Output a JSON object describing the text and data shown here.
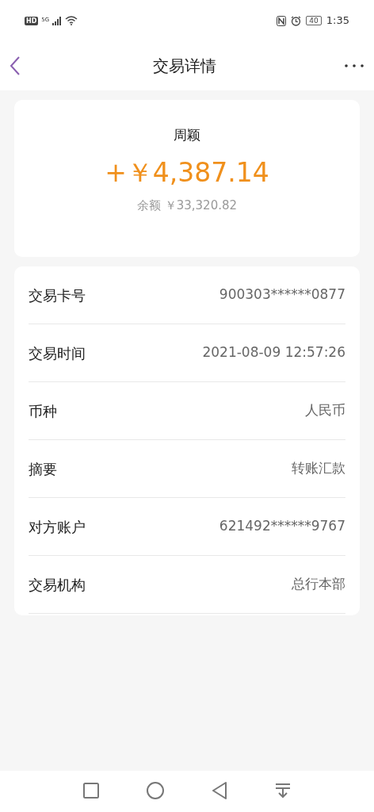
{
  "status_bar": {
    "hd": "HD",
    "network": "5G",
    "battery": "40",
    "time": "1:35"
  },
  "header": {
    "title": "交易详情"
  },
  "summary": {
    "name": "周颖",
    "amount": "+￥4,387.14",
    "balance": "余额 ￥33,320.82"
  },
  "details": [
    {
      "label": "交易卡号",
      "value": "900303******0877"
    },
    {
      "label": "交易时间",
      "value": "2021-08-09 12:57:26"
    },
    {
      "label": "币种",
      "value": "人民币"
    },
    {
      "label": "摘要",
      "value": "转账汇款"
    },
    {
      "label": "对方账户",
      "value": "621492******9767"
    },
    {
      "label": "交易机构",
      "value": "总行本部"
    }
  ]
}
